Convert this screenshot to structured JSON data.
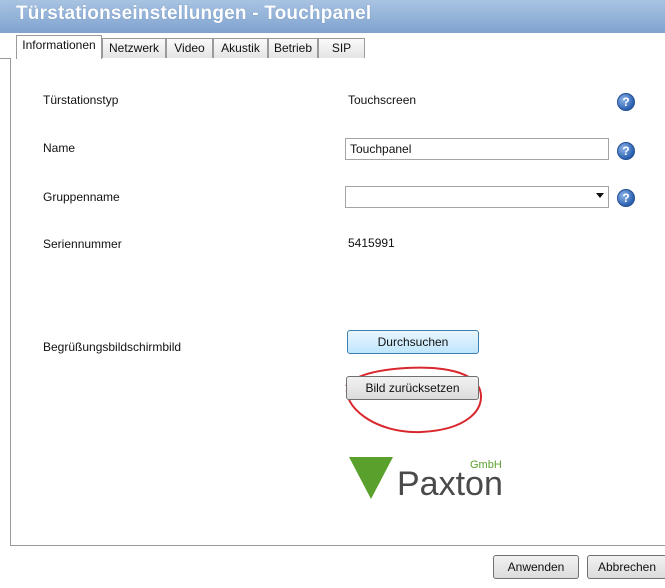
{
  "window": {
    "title": "Türstationseinstellungen - Touchpanel"
  },
  "tabs": [
    {
      "label": "Informationen",
      "active": true
    },
    {
      "label": "Netzwerk"
    },
    {
      "label": "Video"
    },
    {
      "label": "Akustik"
    },
    {
      "label": "Betrieb"
    },
    {
      "label": "SIP"
    }
  ],
  "fields": {
    "type": {
      "label": "Türstationstyp",
      "value": "Touchscreen"
    },
    "name": {
      "label": "Name",
      "value": "Touchpanel"
    },
    "group": {
      "label": "Gruppenname",
      "value": ""
    },
    "serial": {
      "label": "Seriennummer",
      "value": "5415991"
    },
    "welcome": {
      "label": "Begrüßungsbildschirmbild"
    }
  },
  "buttons": {
    "browse": "Durchsuchen",
    "reset": "Bild zurücksetzen",
    "apply": "Anwenden",
    "cancel": "Abbrechen"
  },
  "help_icon": "question-mark-icon",
  "logo": {
    "brand": "Paxton",
    "suffix": "GmbH",
    "brand_color": "#5aa02c",
    "text_color": "#4a4a4a"
  },
  "annotation": {
    "type": "red-circle",
    "color": "#d9272e"
  }
}
